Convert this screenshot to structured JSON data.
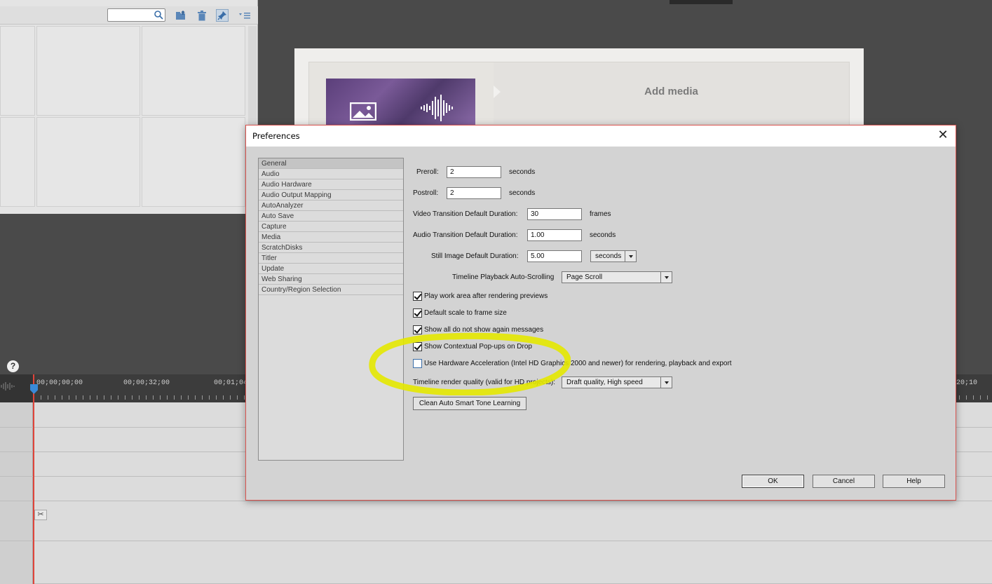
{
  "left_panel": {
    "search": {
      "placeholder": ""
    },
    "toolbar_icons": [
      "search-icon",
      "folder-up-icon",
      "trash-icon",
      "pin-icon",
      "panel-menu-icon"
    ]
  },
  "monitor": {
    "add_media": "Add media"
  },
  "timeline": {
    "help": "?",
    "timecodes": [
      "00;00;00;00",
      "00;00;32;00",
      "00;01;04;",
      "20;10"
    ]
  },
  "dialog": {
    "title": "Preferences",
    "close": "✕",
    "categories": [
      "General",
      "Audio",
      "Audio Hardware",
      "Audio Output Mapping",
      "AutoAnalyzer",
      "Auto Save",
      "Capture",
      "Media",
      "ScratchDisks",
      "Titler",
      "Update",
      "Web Sharing",
      "Country/Region Selection"
    ],
    "selected_category": "General",
    "fields": {
      "preroll": {
        "label": "Preroll:",
        "value": "2",
        "unit": "seconds"
      },
      "postroll": {
        "label": "Postroll:",
        "value": "2",
        "unit": "seconds"
      },
      "video_transition": {
        "label": "Video Transition Default Duration:",
        "value": "30",
        "unit": "frames"
      },
      "audio_transition": {
        "label": "Audio Transition Default Duration:",
        "value": "1.00",
        "unit": "seconds"
      },
      "still_image": {
        "label": "Still Image Default Duration:",
        "value": "5.00",
        "unit_select": "seconds"
      },
      "autoscroll": {
        "label": "Timeline Playback Auto-Scrolling",
        "value": "Page Scroll"
      },
      "render_quality": {
        "label": "Timeline render quality (valid for HD projects):",
        "value": "Draft quality, High speed"
      }
    },
    "checkboxes": [
      {
        "label": "Play work area after rendering previews",
        "checked": true
      },
      {
        "label": "Default scale to frame size",
        "checked": true
      },
      {
        "label": "Show all do not show again messages",
        "checked": true
      },
      {
        "label": "Show Contextual Pop-ups on Drop",
        "checked": true
      },
      {
        "label": "Use Hardware Acceleration (Intel HD Graphics 2000 and newer) for rendering, playback and export",
        "checked": false
      }
    ],
    "clean_button": "Clean Auto Smart Tone Learning",
    "ok": "OK",
    "cancel": "Cancel",
    "help": "Help"
  },
  "colors": {
    "highlight": "#e4e800",
    "dialog_border": "#d9534f"
  }
}
